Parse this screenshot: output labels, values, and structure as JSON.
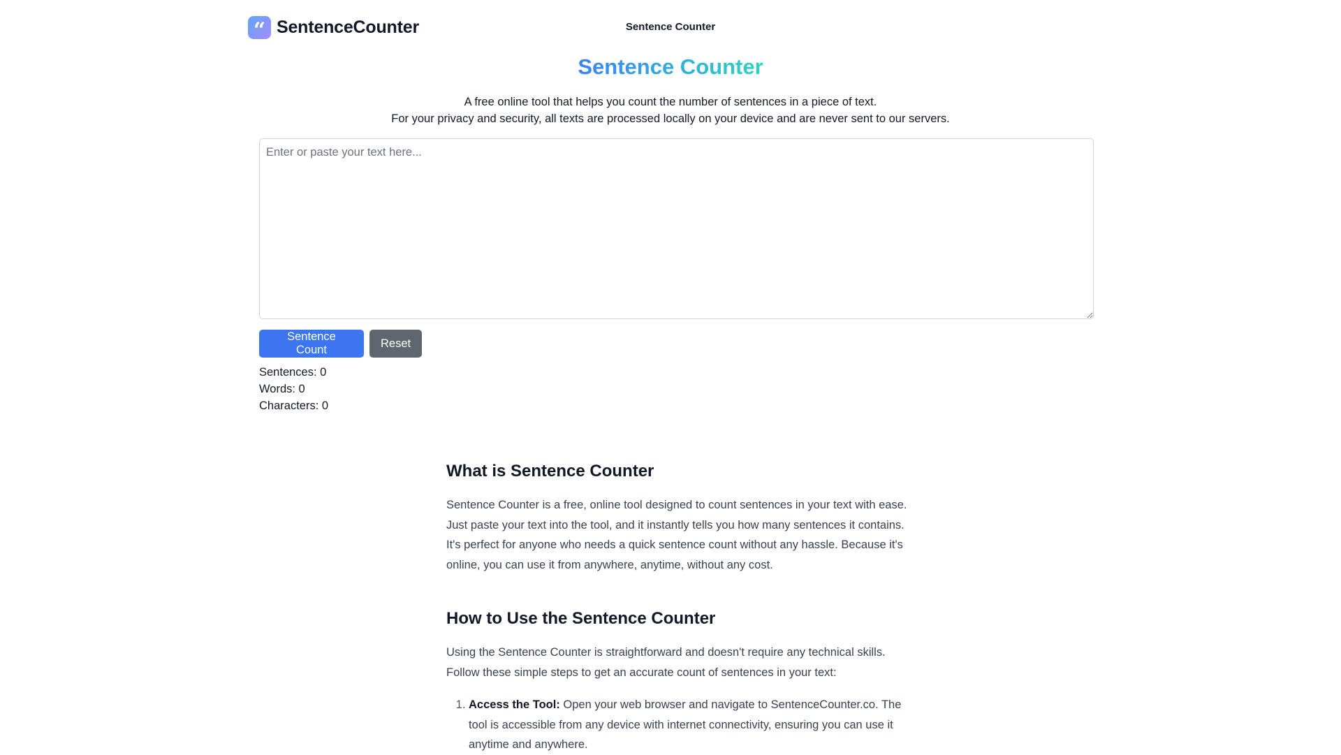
{
  "header": {
    "logo_glyph": "“",
    "logo_text": "SentenceCounter",
    "nav_link": "Sentence Counter"
  },
  "hero": {
    "title": "Sentence Counter",
    "subtitle_line1": "A free online tool that helps you count the number of sentences in a piece of text.",
    "subtitle_line2": "For your privacy and security, all texts are processed locally on your device and are never sent to our servers."
  },
  "editor": {
    "value": "",
    "placeholder": "Enter or paste your text here..."
  },
  "buttons": {
    "count_label": "Sentence Count",
    "reset_label": "Reset"
  },
  "stats": {
    "sentences": "Sentences: 0",
    "words": "Words: 0",
    "characters": "Characters: 0"
  },
  "content": {
    "section1": {
      "heading": "What is Sentence Counter",
      "body": "Sentence Counter is a free, online tool designed to count sentences in your text with ease. Just paste your text into the tool, and it instantly tells you how many sentences it contains. It's perfect for anyone who needs a quick sentence count without any hassle. Because it's online, you can use it from anywhere, anytime, without any cost."
    },
    "section2": {
      "heading": "How to Use the Sentence Counter",
      "body": "Using the Sentence Counter is straightforward and doesn't require any technical skills. Follow these simple steps to get an accurate count of sentences in your text:",
      "steps": [
        {
          "title": "Access the Tool:",
          "text": " Open your web browser and navigate to SentenceCounter.co. The tool is accessible from any device with internet connectivity, ensuring you can use it anytime and anywhere."
        }
      ]
    }
  },
  "colors": {
    "primary_button": "#3b76f0",
    "secondary_button": "#5f666e",
    "title_gradient_start": "#3b82f6",
    "title_gradient_end": "#2dd4bf"
  }
}
